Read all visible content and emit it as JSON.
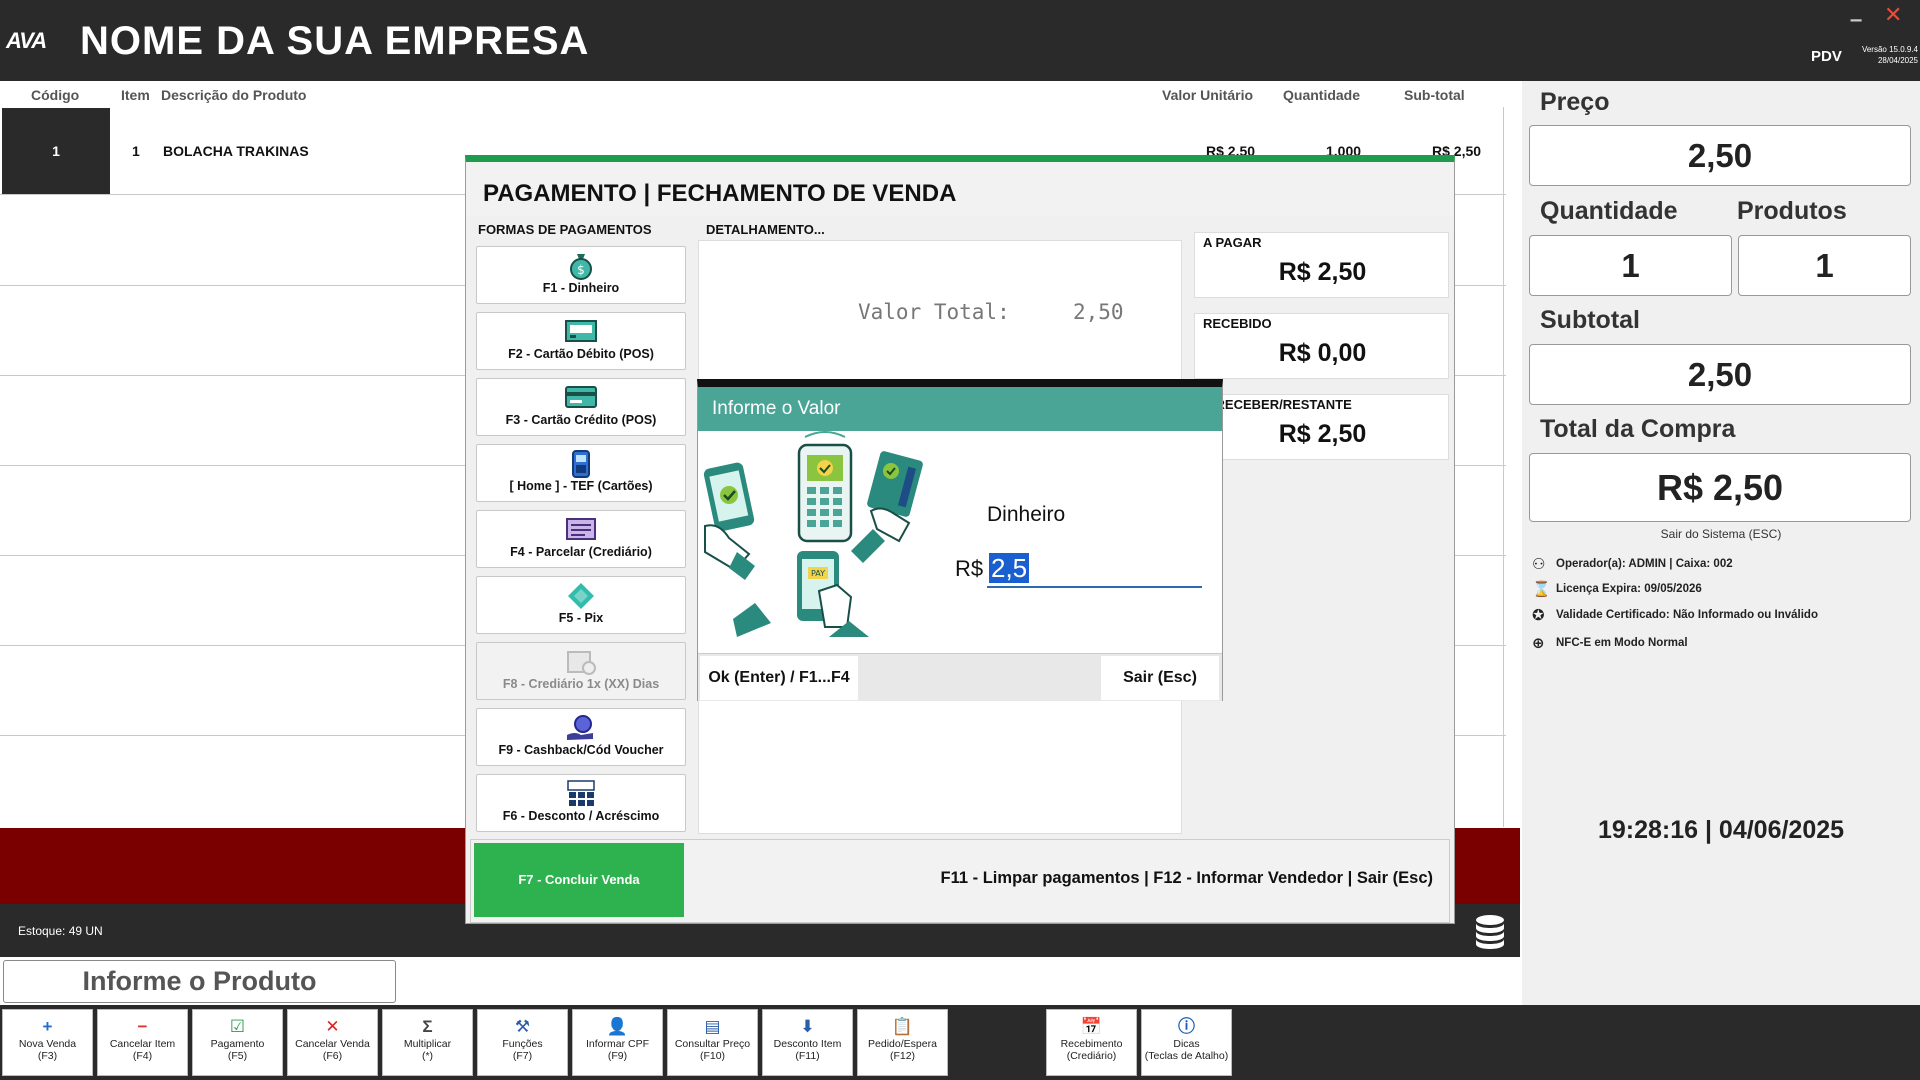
{
  "header": {
    "logo": "AVA",
    "company": "NOME DA SUA EMPRESA",
    "pdv": "PDV",
    "version": "Versão 15.0.9.4",
    "version_date": "28/04/2025"
  },
  "table": {
    "columns": [
      "Código",
      "Item",
      "Descrição do Produto",
      "Valor Unitário",
      "Quantidade",
      "Sub-total"
    ],
    "rows": [
      {
        "codigo": "1",
        "item": "1",
        "descricao": "BOLACHA TRAKINAS",
        "valor_unitario": "R$ 2,50",
        "quantidade": "1,000",
        "subtotal": "R$ 2,50"
      }
    ]
  },
  "status": {
    "stock": "Estoque: 49 UN",
    "product_input_placeholder": "Informe o Produto"
  },
  "function_bar": [
    {
      "icon": "plus-icon",
      "label": "Nova Venda",
      "key": "(F3)"
    },
    {
      "icon": "minus-icon",
      "label": "Cancelar Item",
      "key": "(F4)"
    },
    {
      "icon": "check-icon",
      "label": "Pagamento",
      "key": "(F5)"
    },
    {
      "icon": "x-icon",
      "label": "Cancelar Venda",
      "key": "(F6)"
    },
    {
      "icon": "sigma-icon",
      "label": "Multiplicar",
      "key": "(*)"
    },
    {
      "icon": "tools-icon",
      "label": "Funções",
      "key": "(F7)"
    },
    {
      "icon": "user-icon",
      "label": "Informar CPF",
      "key": "(F9)"
    },
    {
      "icon": "price-icon",
      "label": "Consultar Preço",
      "key": "(F10)"
    },
    {
      "icon": "arrow-down-icon",
      "label": "Desconto Item",
      "key": "(F11)"
    },
    {
      "icon": "clipboard-icon",
      "label": "Pedido/Espera",
      "key": "(F12)"
    },
    {
      "icon": "calendar-icon",
      "label": "Recebimento",
      "key": "(Crediário)"
    },
    {
      "icon": "info-icon",
      "label": "Dicas",
      "key": "(Teclas de Atalho)"
    }
  ],
  "right_panel": {
    "preco_label": "Preço",
    "preco": "2,50",
    "quantidade_label": "Quantidade",
    "quantidade": "1",
    "produtos_label": "Produtos",
    "produtos": "1",
    "subtotal_label": "Subtotal",
    "subtotal": "2,50",
    "total_label": "Total da Compra",
    "total": "R$ 2,50",
    "sair": "Sair do Sistema (ESC)",
    "operador": "Operador(a): ADMIN | Caixa: 002",
    "licenca": "Licença Expira: 09/05/2026",
    "certificado": "Validade Certificado: Não Informado ou Inválido",
    "nfce": "NFC-E em Modo Normal",
    "clock": "19:28:16 | 04/06/2025"
  },
  "payment_modal": {
    "title": "PAGAMENTO | FECHAMENTO DE VENDA",
    "formas_label": "FORMAS DE PAGAMENTOS",
    "detalhamento_label": "DETALHAMENTO...",
    "methods": [
      {
        "icon": "money-bag-icon",
        "label": "F1 - Dinheiro",
        "enabled": true
      },
      {
        "icon": "pos-debit-icon",
        "label": "F2 - Cartão Débito (POS)",
        "enabled": true
      },
      {
        "icon": "pos-credit-icon",
        "label": "F3 - Cartão Crédito (POS)",
        "enabled": true
      },
      {
        "icon": "tef-terminal-icon",
        "label": "[ Home ] - TEF (Cartões)",
        "enabled": true
      },
      {
        "icon": "installments-icon",
        "label": "F4 - Parcelar (Crediário)",
        "enabled": true
      },
      {
        "icon": "pix-icon",
        "label": "F5 - Pix",
        "enabled": true
      },
      {
        "icon": "calendar-clock-icon",
        "label": "F8 - Crediário 1x (XX) Dias",
        "enabled": false
      },
      {
        "icon": "cashback-icon",
        "label": "F9 - Cashback/Cód Voucher",
        "enabled": true
      },
      {
        "icon": "discount-icon",
        "label": "F6 - Desconto / Acréscimo",
        "enabled": true
      }
    ],
    "valor_total_label": "Valor Total:",
    "valor_total": "2,50",
    "a_pagar_label": "A PAGAR",
    "a_pagar": "R$ 2,50",
    "recebido_label": "RECEBIDO",
    "recebido": "R$ 0,00",
    "restante_label": "A RECEBER/RESTANTE",
    "restante": "R$ 2,50",
    "concluir": "F7 - Concluir Venda",
    "shortcuts": "F11 - Limpar pagamentos | F12 - Informar Vendedor | Sair (Esc)"
  },
  "value_dialog": {
    "title": "Informe o Valor",
    "method": "Dinheiro",
    "currency": "R$",
    "value": "2,5",
    "ok": "Ok (Enter) / F1...F4",
    "sair": "Sair (Esc)"
  },
  "colors": {
    "header_bg": "#2a2a2a",
    "accent_green": "#1e9b4c",
    "dialog_teal": "#4aa596",
    "red_band": "#7a0000"
  }
}
